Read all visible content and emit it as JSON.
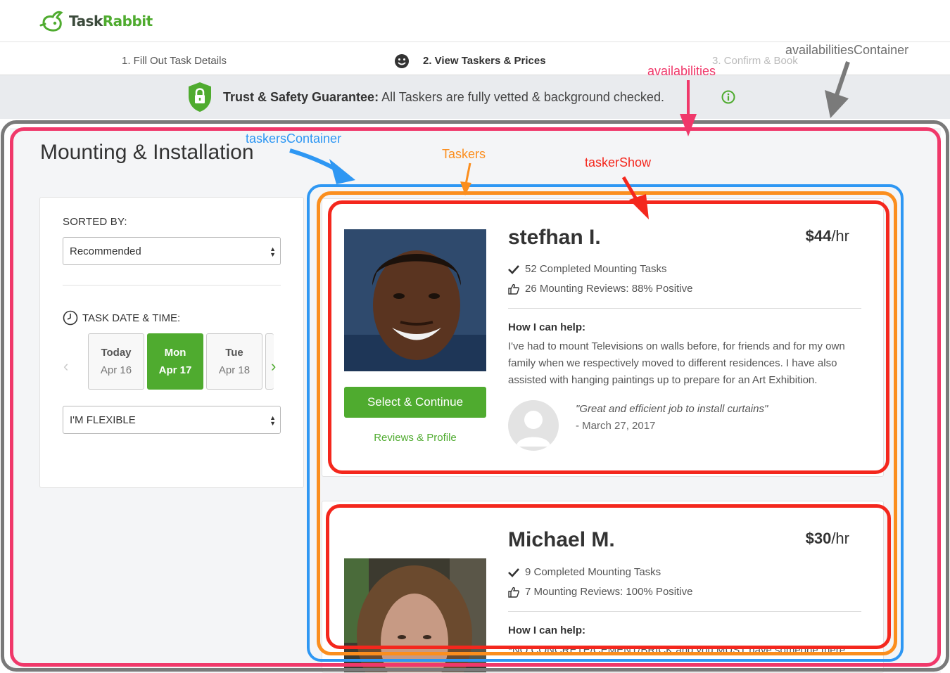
{
  "brand": {
    "part1": "Task",
    "part2": "Rabbit"
  },
  "steps": [
    {
      "label": "1. Fill Out Task Details"
    },
    {
      "label": "2. View Taskers & Prices"
    },
    {
      "label": "3. Confirm & Book"
    }
  ],
  "trust": {
    "bold": "Trust & Safety Guarantee:",
    "text": " All Taskers are fully vetted & background checked."
  },
  "page_title": "Mounting & Installation",
  "sidebar": {
    "sort_label": "SORTED BY:",
    "sort_value": "Recommended",
    "date_label": "TASK DATE & TIME:",
    "days": [
      {
        "name": "Today",
        "date": "Apr 16"
      },
      {
        "name": "Mon",
        "date": "Apr 17",
        "selected": true
      },
      {
        "name": "Tue",
        "date": "Apr 18"
      }
    ],
    "time_value": "I'M FLEXIBLE"
  },
  "taskers": [
    {
      "name": "stefhan I.",
      "rate_amount": "$44",
      "rate_unit": "/hr",
      "completed": "52 Completed Mounting Tasks",
      "reviews": "26 Mounting Reviews: 88% Positive",
      "help_heading": "How I can help:",
      "help_text": "I've had to mount Televisions on walls before, for friends and for my own family when we respectively moved to different residences. I have also assisted with hanging paintings up to prepare for an Art Exhibition.",
      "select_label": "Select & Continue",
      "profile_label": "Reviews & Profile",
      "review_quote": "\"Great and efficient job to install curtains\"",
      "review_date": "- March 27, 2017"
    },
    {
      "name": "Michael M.",
      "rate_amount": "$30",
      "rate_unit": "/hr",
      "completed": "9 Completed Mounting Tasks",
      "reviews": "7 Mounting Reviews: 100% Positive",
      "help_heading": "How I can help:",
      "help_text": "*NO CONCRETE/CEMENT/BRICK and you MUST have someone there"
    }
  ],
  "annotations": {
    "availabilities_container": "availabilitiesContainer",
    "availabilities": "availabilities",
    "taskers_container": "taskersContainer",
    "taskers": "Taskers",
    "tasker_show": "taskerShow"
  },
  "colors": {
    "brand_green": "#4fab2f",
    "annotation_gray": "#7a7a7a",
    "annotation_pink": "#f0386a",
    "annotation_blue": "#2e97f3",
    "annotation_orange": "#fb8e1e",
    "annotation_red": "#f4271d"
  }
}
